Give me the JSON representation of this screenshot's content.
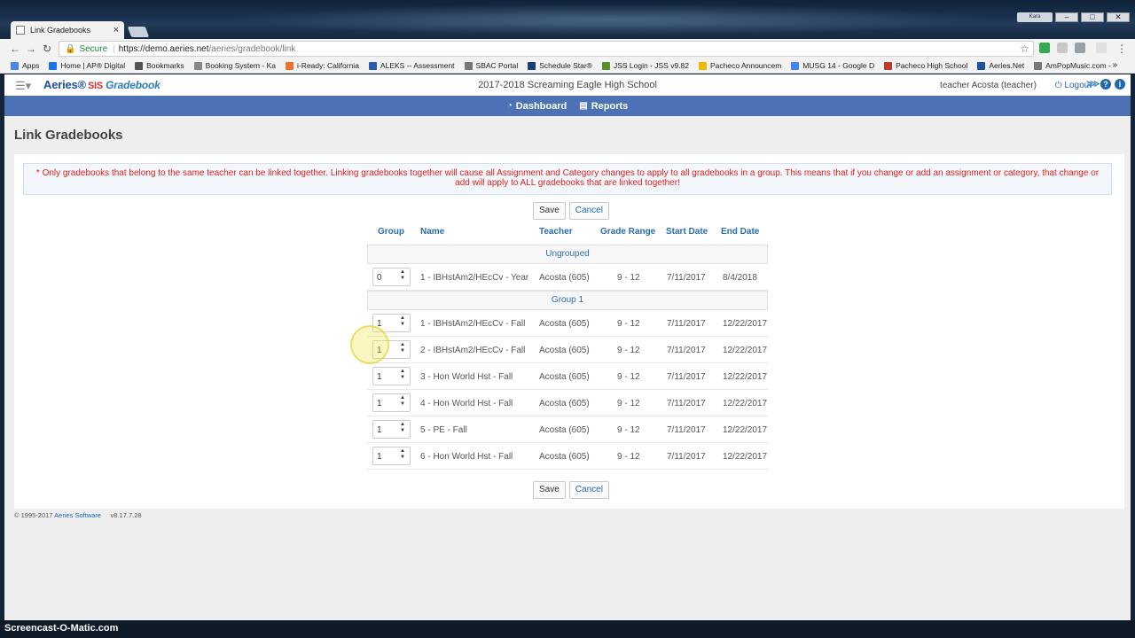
{
  "browser": {
    "tab_title": "Link Gradebooks",
    "tab_close": "×",
    "window_user": "Kara",
    "url_secure_label": "Secure",
    "url_host": "https://demo.aeries.net",
    "url_path": "/aeries/gradebook/link",
    "bookmarks": [
      {
        "label": "Apps",
        "color": "#4a86e8"
      },
      {
        "label": "Home | AP® Digital",
        "color": "#1a73e8"
      },
      {
        "label": "Bookmarks",
        "color": "#555555"
      },
      {
        "label": "Booking System - Ka",
        "color": "#888888"
      },
      {
        "label": "i-Ready: California",
        "color": "#e8732c"
      },
      {
        "label": "ALEKS -- Assessment",
        "color": "#2a5db0"
      },
      {
        "label": "SBAC Portal",
        "color": "#777777"
      },
      {
        "label": "Schedule Star®",
        "color": "#1b3d7a"
      },
      {
        "label": "JSS Login - JSS v9.82",
        "color": "#5b8f2c"
      },
      {
        "label": "Pacheco Announcem",
        "color": "#f2b705"
      },
      {
        "label": "MUSG 14 - Google D",
        "color": "#4285f4"
      },
      {
        "label": "Pacheco High School",
        "color": "#c0392b"
      },
      {
        "label": "Aeries.Net",
        "color": "#1f4f9d"
      },
      {
        "label": "AmPopMusic.com -",
        "color": "#777777"
      }
    ],
    "bookmarks_more": "»"
  },
  "app": {
    "logo_main": "Aeries®",
    "logo_sis": "SIS",
    "logo_gradebook": "Gradebook",
    "school": "2017-2018 Screaming Eagle High School",
    "user": "teacher Acosta (teacher)",
    "logout": "Logout",
    "nav": [
      {
        "label": "Dashboard",
        "icon": "dashboard-icon"
      },
      {
        "label": "Reports",
        "icon": "file-icon"
      }
    ]
  },
  "page": {
    "title": "Link Gradebooks",
    "warning": "* Only gradebooks that belong to the same teacher can be linked together. Linking gradebooks together will cause all Assignment and Category changes to apply to all gradebooks in a group. This means that if you change or add an assignment or category, that change or add will apply to ALL gradebooks that are linked together!",
    "save_label": "Save",
    "cancel_label": "Cancel",
    "columns": {
      "group": "Group",
      "name": "Name",
      "teacher": "Teacher",
      "range": "Grade Range",
      "start": "Start Date",
      "end": "End Date"
    },
    "ungrouped_label": "Ungrouped",
    "group1_label": "Group 1",
    "ungrouped_rows": [
      {
        "group": "0",
        "name": "1 - IBHstAm2/HEcCv - Year",
        "teacher": "Acosta (605)",
        "range": "9 - 12",
        "start": "7/11/2017",
        "end": "8/4/2018"
      }
    ],
    "group1_rows": [
      {
        "group": "1",
        "name": "1 - IBHstAm2/HEcCv - Fall",
        "teacher": "Acosta (605)",
        "range": "9 - 12",
        "start": "7/11/2017",
        "end": "12/22/2017"
      },
      {
        "group": "1",
        "name": "2 - IBHstAm2/HEcCv - Fall",
        "teacher": "Acosta (605)",
        "range": "9 - 12",
        "start": "7/11/2017",
        "end": "12/22/2017"
      },
      {
        "group": "1",
        "name": "3 - Hon World Hst - Fall",
        "teacher": "Acosta (605)",
        "range": "9 - 12",
        "start": "7/11/2017",
        "end": "12/22/2017"
      },
      {
        "group": "1",
        "name": "4 - Hon World Hst - Fall",
        "teacher": "Acosta (605)",
        "range": "9 - 12",
        "start": "7/11/2017",
        "end": "12/22/2017"
      },
      {
        "group": "1",
        "name": "5 - PE - Fall",
        "teacher": "Acosta (605)",
        "range": "9 - 12",
        "start": "7/11/2017",
        "end": "12/22/2017"
      },
      {
        "group": "1",
        "name": "6 - Hon World Hst - Fall",
        "teacher": "Acosta (605)",
        "range": "9 - 12",
        "start": "7/11/2017",
        "end": "12/22/2017"
      }
    ]
  },
  "footer": {
    "copyright": "© 1995-2017",
    "company": "Aeries Software",
    "version": "v8.17.7.28"
  },
  "watermark": "Screencast-O-Matic.com"
}
